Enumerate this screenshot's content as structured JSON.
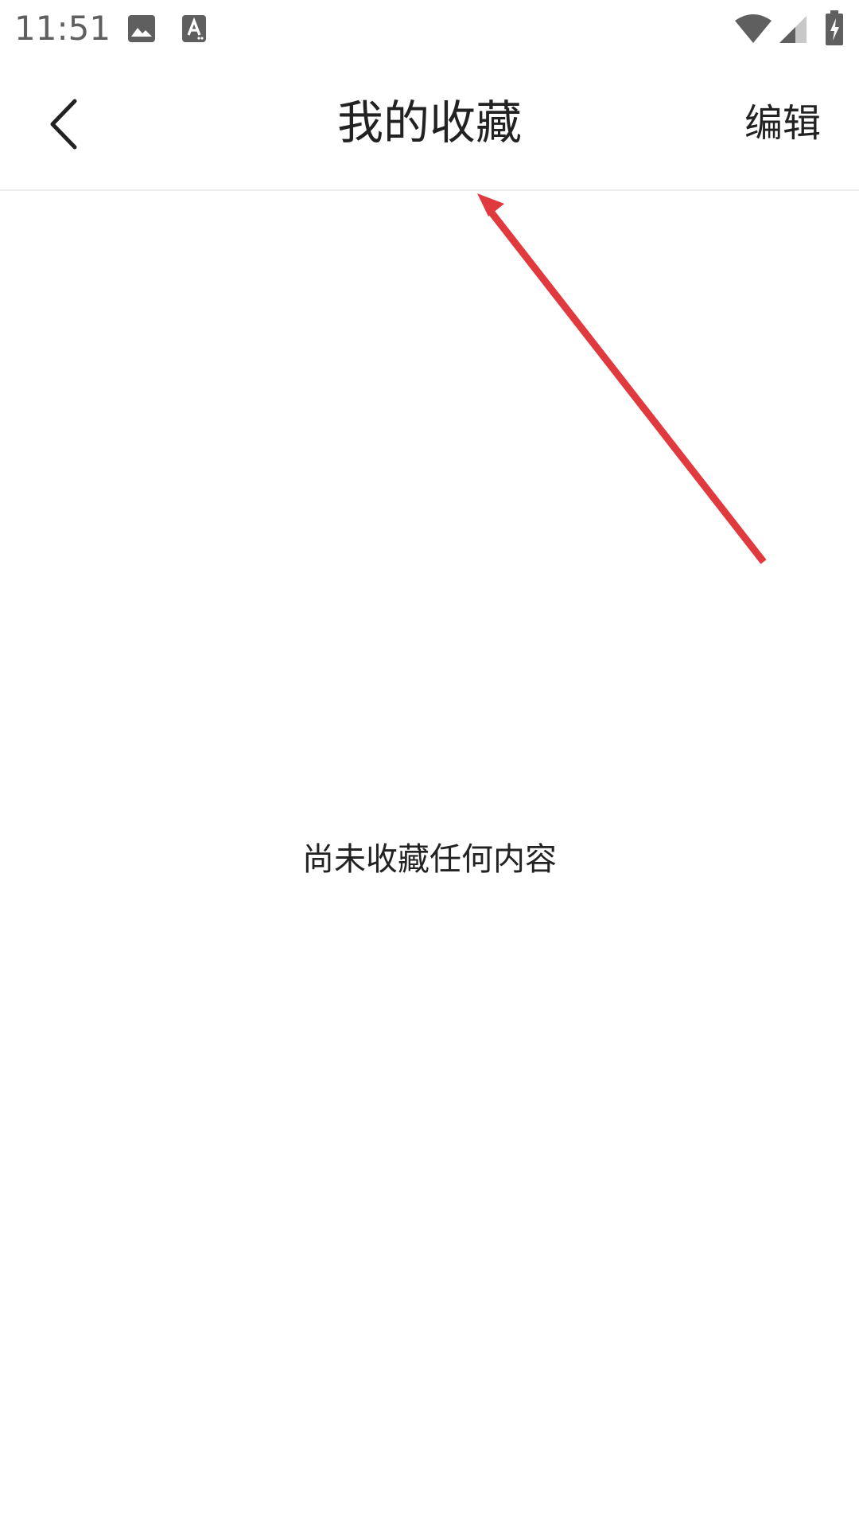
{
  "status_bar": {
    "time": "11:51",
    "icons": [
      "image-notification-icon",
      "text-notification-icon",
      "wifi-icon",
      "cell-signal-icon",
      "battery-charging-icon"
    ]
  },
  "app_bar": {
    "title": "我的收藏",
    "edit_label": "编辑",
    "back_icon": "chevron-left-icon"
  },
  "content": {
    "empty_message": "尚未收藏任何内容"
  },
  "colors": {
    "text_primary": "#222222",
    "status_text": "#5f5f5f",
    "divider": "#ececec",
    "annotation_arrow": "#e03a3e",
    "background": "#ffffff"
  }
}
